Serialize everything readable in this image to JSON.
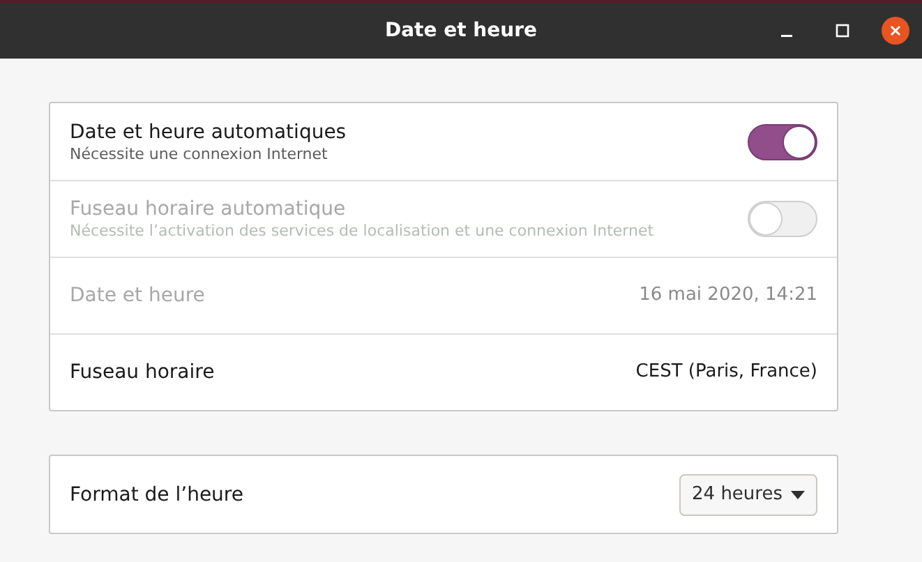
{
  "window": {
    "title": "Date et heure"
  },
  "sections": [
    {
      "rows": [
        {
          "kind": "switch",
          "label": "Date et heure automatiques",
          "subtitle": "Nécessite une connexion Internet",
          "on": true,
          "disabled": false
        },
        {
          "kind": "switch",
          "label": "Fuseau horaire automatique",
          "subtitle": "Nécessite l’activation des services de localisation et une connexion Internet",
          "on": false,
          "disabled": true
        },
        {
          "kind": "value",
          "label": "Date et heure",
          "value": "16 mai 2020, 14:21",
          "disabled": true
        },
        {
          "kind": "value",
          "label": "Fuseau horaire",
          "value": "CEST (Paris, France)",
          "disabled": false
        }
      ]
    },
    {
      "rows": [
        {
          "kind": "dropdown",
          "label": "Format de l’heure",
          "value": "24 heures",
          "disabled": false
        }
      ]
    }
  ]
}
